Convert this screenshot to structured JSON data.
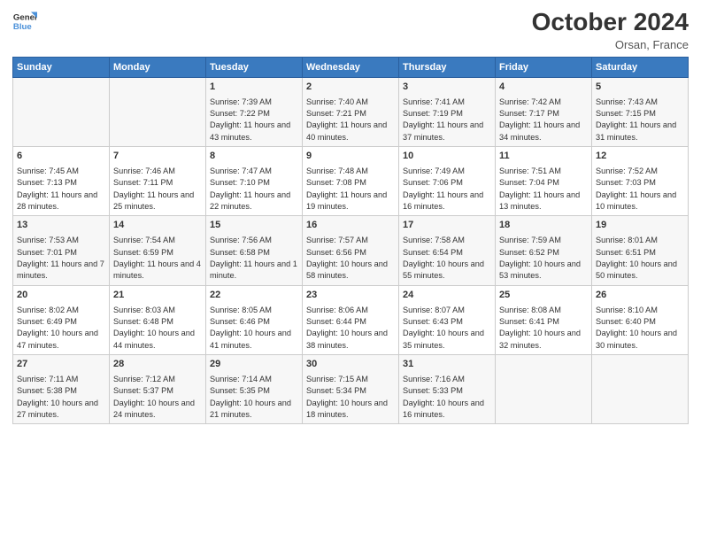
{
  "header": {
    "logo_line1": "General",
    "logo_line2": "Blue",
    "month": "October 2024",
    "location": "Orsan, France"
  },
  "weekdays": [
    "Sunday",
    "Monday",
    "Tuesday",
    "Wednesday",
    "Thursday",
    "Friday",
    "Saturday"
  ],
  "weeks": [
    [
      {
        "day": "",
        "sunrise": "",
        "sunset": "",
        "daylight": ""
      },
      {
        "day": "",
        "sunrise": "",
        "sunset": "",
        "daylight": ""
      },
      {
        "day": "1",
        "sunrise": "Sunrise: 7:39 AM",
        "sunset": "Sunset: 7:22 PM",
        "daylight": "Daylight: 11 hours and 43 minutes."
      },
      {
        "day": "2",
        "sunrise": "Sunrise: 7:40 AM",
        "sunset": "Sunset: 7:21 PM",
        "daylight": "Daylight: 11 hours and 40 minutes."
      },
      {
        "day": "3",
        "sunrise": "Sunrise: 7:41 AM",
        "sunset": "Sunset: 7:19 PM",
        "daylight": "Daylight: 11 hours and 37 minutes."
      },
      {
        "day": "4",
        "sunrise": "Sunrise: 7:42 AM",
        "sunset": "Sunset: 7:17 PM",
        "daylight": "Daylight: 11 hours and 34 minutes."
      },
      {
        "day": "5",
        "sunrise": "Sunrise: 7:43 AM",
        "sunset": "Sunset: 7:15 PM",
        "daylight": "Daylight: 11 hours and 31 minutes."
      }
    ],
    [
      {
        "day": "6",
        "sunrise": "Sunrise: 7:45 AM",
        "sunset": "Sunset: 7:13 PM",
        "daylight": "Daylight: 11 hours and 28 minutes."
      },
      {
        "day": "7",
        "sunrise": "Sunrise: 7:46 AM",
        "sunset": "Sunset: 7:11 PM",
        "daylight": "Daylight: 11 hours and 25 minutes."
      },
      {
        "day": "8",
        "sunrise": "Sunrise: 7:47 AM",
        "sunset": "Sunset: 7:10 PM",
        "daylight": "Daylight: 11 hours and 22 minutes."
      },
      {
        "day": "9",
        "sunrise": "Sunrise: 7:48 AM",
        "sunset": "Sunset: 7:08 PM",
        "daylight": "Daylight: 11 hours and 19 minutes."
      },
      {
        "day": "10",
        "sunrise": "Sunrise: 7:49 AM",
        "sunset": "Sunset: 7:06 PM",
        "daylight": "Daylight: 11 hours and 16 minutes."
      },
      {
        "day": "11",
        "sunrise": "Sunrise: 7:51 AM",
        "sunset": "Sunset: 7:04 PM",
        "daylight": "Daylight: 11 hours and 13 minutes."
      },
      {
        "day": "12",
        "sunrise": "Sunrise: 7:52 AM",
        "sunset": "Sunset: 7:03 PM",
        "daylight": "Daylight: 11 hours and 10 minutes."
      }
    ],
    [
      {
        "day": "13",
        "sunrise": "Sunrise: 7:53 AM",
        "sunset": "Sunset: 7:01 PM",
        "daylight": "Daylight: 11 hours and 7 minutes."
      },
      {
        "day": "14",
        "sunrise": "Sunrise: 7:54 AM",
        "sunset": "Sunset: 6:59 PM",
        "daylight": "Daylight: 11 hours and 4 minutes."
      },
      {
        "day": "15",
        "sunrise": "Sunrise: 7:56 AM",
        "sunset": "Sunset: 6:58 PM",
        "daylight": "Daylight: 11 hours and 1 minute."
      },
      {
        "day": "16",
        "sunrise": "Sunrise: 7:57 AM",
        "sunset": "Sunset: 6:56 PM",
        "daylight": "Daylight: 10 hours and 58 minutes."
      },
      {
        "day": "17",
        "sunrise": "Sunrise: 7:58 AM",
        "sunset": "Sunset: 6:54 PM",
        "daylight": "Daylight: 10 hours and 55 minutes."
      },
      {
        "day": "18",
        "sunrise": "Sunrise: 7:59 AM",
        "sunset": "Sunset: 6:52 PM",
        "daylight": "Daylight: 10 hours and 53 minutes."
      },
      {
        "day": "19",
        "sunrise": "Sunrise: 8:01 AM",
        "sunset": "Sunset: 6:51 PM",
        "daylight": "Daylight: 10 hours and 50 minutes."
      }
    ],
    [
      {
        "day": "20",
        "sunrise": "Sunrise: 8:02 AM",
        "sunset": "Sunset: 6:49 PM",
        "daylight": "Daylight: 10 hours and 47 minutes."
      },
      {
        "day": "21",
        "sunrise": "Sunrise: 8:03 AM",
        "sunset": "Sunset: 6:48 PM",
        "daylight": "Daylight: 10 hours and 44 minutes."
      },
      {
        "day": "22",
        "sunrise": "Sunrise: 8:05 AM",
        "sunset": "Sunset: 6:46 PM",
        "daylight": "Daylight: 10 hours and 41 minutes."
      },
      {
        "day": "23",
        "sunrise": "Sunrise: 8:06 AM",
        "sunset": "Sunset: 6:44 PM",
        "daylight": "Daylight: 10 hours and 38 minutes."
      },
      {
        "day": "24",
        "sunrise": "Sunrise: 8:07 AM",
        "sunset": "Sunset: 6:43 PM",
        "daylight": "Daylight: 10 hours and 35 minutes."
      },
      {
        "day": "25",
        "sunrise": "Sunrise: 8:08 AM",
        "sunset": "Sunset: 6:41 PM",
        "daylight": "Daylight: 10 hours and 32 minutes."
      },
      {
        "day": "26",
        "sunrise": "Sunrise: 8:10 AM",
        "sunset": "Sunset: 6:40 PM",
        "daylight": "Daylight: 10 hours and 30 minutes."
      }
    ],
    [
      {
        "day": "27",
        "sunrise": "Sunrise: 7:11 AM",
        "sunset": "Sunset: 5:38 PM",
        "daylight": "Daylight: 10 hours and 27 minutes."
      },
      {
        "day": "28",
        "sunrise": "Sunrise: 7:12 AM",
        "sunset": "Sunset: 5:37 PM",
        "daylight": "Daylight: 10 hours and 24 minutes."
      },
      {
        "day": "29",
        "sunrise": "Sunrise: 7:14 AM",
        "sunset": "Sunset: 5:35 PM",
        "daylight": "Daylight: 10 hours and 21 minutes."
      },
      {
        "day": "30",
        "sunrise": "Sunrise: 7:15 AM",
        "sunset": "Sunset: 5:34 PM",
        "daylight": "Daylight: 10 hours and 18 minutes."
      },
      {
        "day": "31",
        "sunrise": "Sunrise: 7:16 AM",
        "sunset": "Sunset: 5:33 PM",
        "daylight": "Daylight: 10 hours and 16 minutes."
      },
      {
        "day": "",
        "sunrise": "",
        "sunset": "",
        "daylight": ""
      },
      {
        "day": "",
        "sunrise": "",
        "sunset": "",
        "daylight": ""
      }
    ]
  ]
}
